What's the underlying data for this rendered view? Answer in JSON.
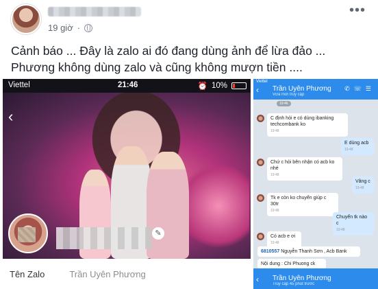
{
  "post": {
    "time": "19 giờ",
    "more_label": "•••",
    "text": "Cảnh báo ... Đây là zalo ai đó đang dùng ảnh để lừa đảo ... Phương không dùng zalo và cũng không mượn tiền ...."
  },
  "phone": {
    "carrier": "Viettel",
    "time": "21:46",
    "battery": "10%",
    "back_icon": "‹",
    "edit_icon": "✎",
    "zalo_label": "Tên Zalo",
    "zalo_name": "Trần Uyên Phương"
  },
  "chat": {
    "carrier": "Viettel",
    "contact_name": "Trần Uyên Phương",
    "contact_sub": "Vừa mới truy cập",
    "date_sep": "19:46",
    "messages": [
      {
        "dir": "in",
        "text": "C định hỏi e có dùng ibanking techcombank ko",
        "time": "19:48"
      },
      {
        "dir": "out",
        "text": "E dùng acb",
        "time": "19:48"
      },
      {
        "dir": "in",
        "text": "Chứ c hỏi bên nhận có acb ko nhé",
        "time": "19:48"
      },
      {
        "dir": "out",
        "text": "Vâng c",
        "time": "19:48"
      },
      {
        "dir": "in",
        "text": "Tk e còn ko chuyển giúp c 30tr",
        "time": "19:48"
      },
      {
        "dir": "out",
        "text": "Chuyển tk nào c",
        "time": "19:48"
      },
      {
        "dir": "in",
        "text": "Có acb e ơi",
        "time": "19:48"
      }
    ],
    "account_number": "6810557",
    "account_rest": "Nguyễn Thanh Sơn , Acb Bank",
    "note": "Nội dung : Chi Phuong ck",
    "bottom_name": "Trần Uyên Phương",
    "bottom_sub": "Truy cập 45 phút trước"
  }
}
